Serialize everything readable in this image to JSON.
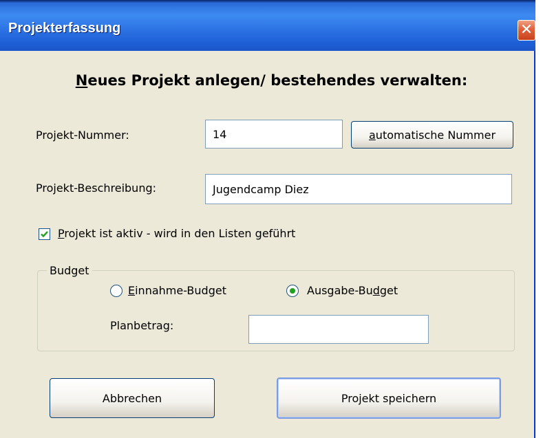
{
  "window": {
    "title": "Projekterfassung",
    "close_glyph": "✕"
  },
  "heading": {
    "accel": "N",
    "rest": "eues Projekt anlegen/ bestehendes verwalten:"
  },
  "projekt_nummer": {
    "label": "Projekt-Nummer:",
    "value": "14",
    "auto_button": {
      "accel": "a",
      "rest": "utomatische Nummer"
    }
  },
  "projekt_beschreibung": {
    "label": "Projekt-Beschreibung:",
    "value": "Jugendcamp Diez"
  },
  "aktiv": {
    "checked": true,
    "accel": "P",
    "rest": "rojekt ist aktiv - wird in den Listen geführt"
  },
  "budget": {
    "legend": "Budget",
    "einnahme": {
      "accel": "E",
      "rest": "innahme-Budget",
      "selected": false
    },
    "ausgabe": {
      "pre": "Ausgabe-Bu",
      "accel": "d",
      "post": "get",
      "selected": true
    },
    "planbetrag_label": "Planbetrag:",
    "planbetrag_value": ""
  },
  "buttons": {
    "cancel": "Abbrechen",
    "save": "Projekt speichern"
  },
  "colors": {
    "titlebar": "#2b71e3",
    "face": "#ece9d8",
    "close": "#e0623c",
    "radio_dot": "#21a121"
  }
}
